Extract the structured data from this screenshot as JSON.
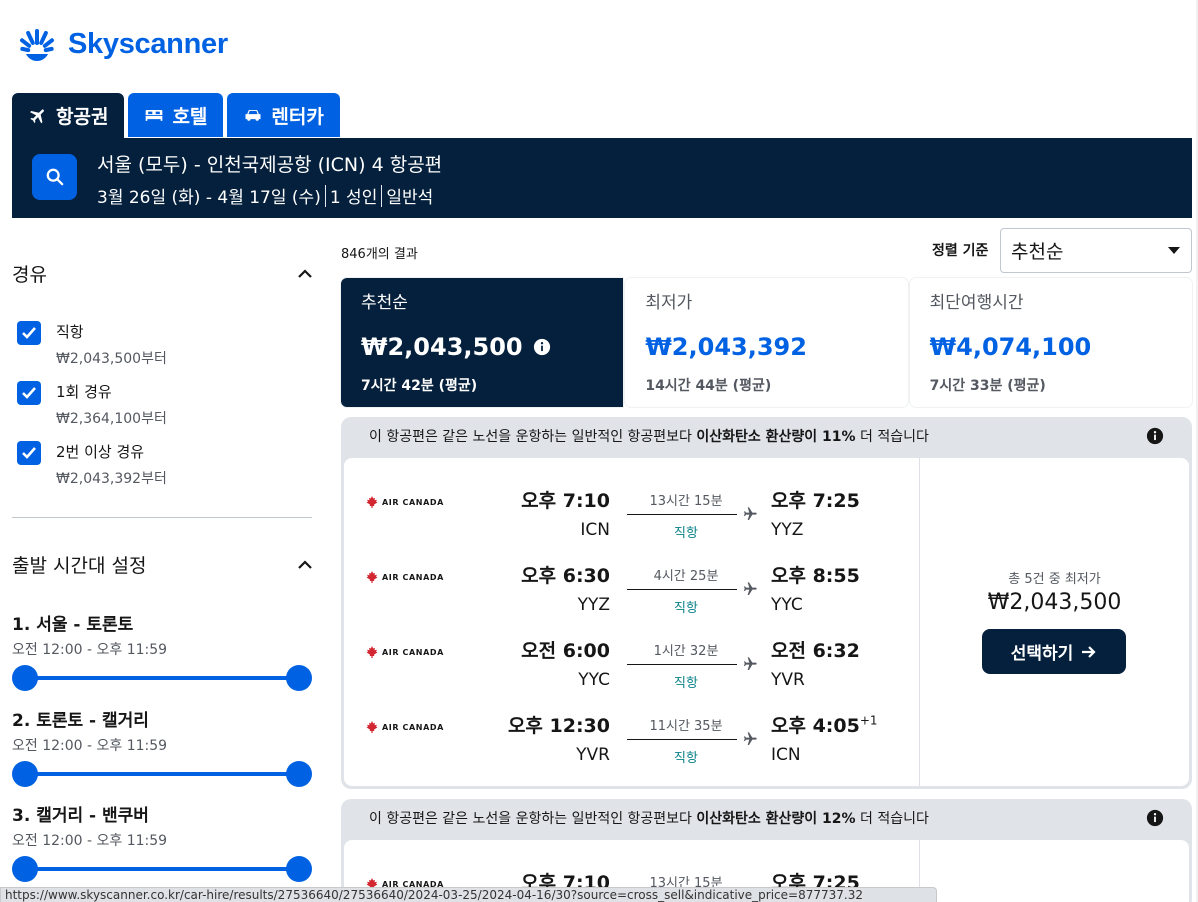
{
  "brand": {
    "name": "Skyscanner",
    "color": "#0062e3",
    "navy": "#05203c"
  },
  "tabs": [
    {
      "label": "항공권",
      "icon": "plane-icon",
      "active": true
    },
    {
      "label": "호텔",
      "icon": "bed-icon",
      "active": false
    },
    {
      "label": "렌터카",
      "icon": "car-icon",
      "active": false
    }
  ],
  "search": {
    "route": "서울 (모두) - 인천국제공항 (ICN) 4 항공편",
    "dates": "3월 26일 (화) - 4월 17일 (수)",
    "travellers": "1 성인",
    "cabin": "일반석"
  },
  "filters": {
    "stops_title": "경유",
    "stops": [
      {
        "label": "직항",
        "price": "₩2,043,500부터",
        "checked": true
      },
      {
        "label": "1회 경유",
        "price": "₩2,364,100부터",
        "checked": true
      },
      {
        "label": "2번 이상 경유",
        "price": "₩2,043,392부터",
        "checked": true
      }
    ],
    "time_title": "출발 시간대 설정",
    "legs": [
      {
        "title": "1. 서울 - 토론토",
        "range": "오전 12:00 - 오후 11:59"
      },
      {
        "title": "2. 토론토 - 캘거리",
        "range": "오전 12:00 - 오후 11:59"
      },
      {
        "title": "3. 캘거리 - 밴쿠버",
        "range": "오전 12:00 - 오후 11:59"
      }
    ]
  },
  "results": {
    "count": "846개의 결과",
    "sort_label": "정렬 기준",
    "sort_value": "추천순",
    "sort_cards": [
      {
        "name": "추천순",
        "price": "₩2,043,500",
        "duration": "7시간 42분 (평균)",
        "active": true
      },
      {
        "name": "최저가",
        "price": "₩2,043,392",
        "duration": "14시간 44분 (평균)",
        "active": false
      },
      {
        "name": "최단여행시간",
        "price": "₩4,074,100",
        "duration": "7시간 33분 (평균)",
        "active": false
      }
    ],
    "cards": [
      {
        "eco_pre": "이 항공편은 같은 노선을 운항하는 일반적인 항공편보다 ",
        "eco_bold": "이산화탄소 환산량이 11%",
        "eco_post": " 더 적습니다",
        "legs": [
          {
            "airline": "AIR CANADA",
            "dep_time": "오후 7:10",
            "dep_code": "ICN",
            "duration": "13시간 15분",
            "stops": "직항",
            "arr_time": "오후 7:25",
            "arr_code": "YYZ",
            "plus": ""
          },
          {
            "airline": "AIR CANADA",
            "dep_time": "오후 6:30",
            "dep_code": "YYZ",
            "duration": "4시간 25분",
            "stops": "직항",
            "arr_time": "오후 8:55",
            "arr_code": "YYC",
            "plus": ""
          },
          {
            "airline": "AIR CANADA",
            "dep_time": "오전 6:00",
            "dep_code": "YYC",
            "duration": "1시간 32분",
            "stops": "직항",
            "arr_time": "오전 6:32",
            "arr_code": "YVR",
            "plus": ""
          },
          {
            "airline": "AIR CANADA",
            "dep_time": "오후 12:30",
            "dep_code": "YVR",
            "duration": "11시간 35분",
            "stops": "직항",
            "arr_time": "오후 4:05",
            "arr_code": "ICN",
            "plus": "+1"
          }
        ],
        "price_note": "총 5건 중 최저가",
        "price": "₩2,043,500",
        "select_label": "선택하기"
      },
      {
        "eco_pre": "이 항공편은 같은 노선을 운항하는 일반적인 항공편보다 ",
        "eco_bold": "이산화탄소 환산량이 12%",
        "eco_post": " 더 적습니다",
        "legs": [
          {
            "airline": "AIR CANADA",
            "dep_time": "오후 7:10",
            "dep_code": "",
            "duration": "13시간 15분",
            "stops": "",
            "arr_time": "오후 7:25",
            "arr_code": "",
            "plus": ""
          }
        ]
      }
    ]
  },
  "status_bar_url": "https://www.skyscanner.co.kr/car-hire/results/27536640/27536640/2024-03-25/2024-04-16/30?source=cross_sell&indicative_price=877737.32"
}
